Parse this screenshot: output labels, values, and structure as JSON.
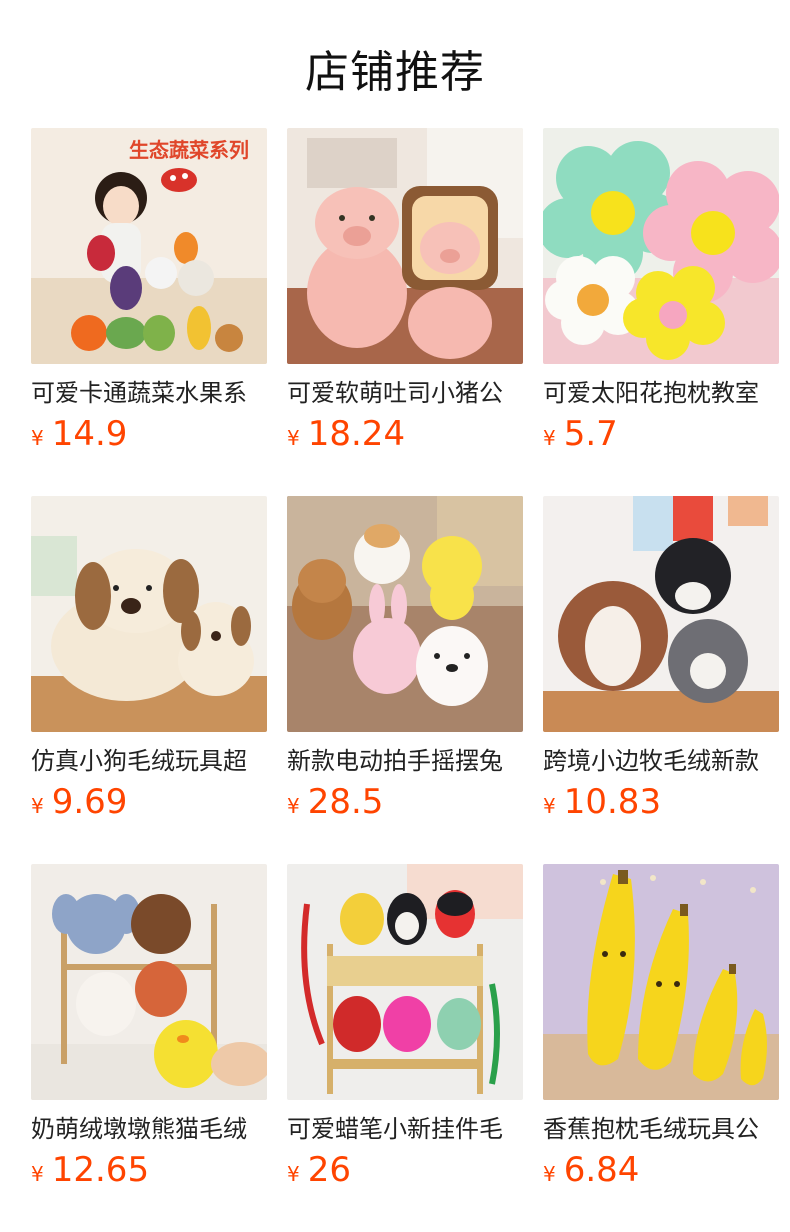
{
  "header": {
    "title": "店铺推荐"
  },
  "currency_symbol": "¥",
  "colors": {
    "price": "#ff4400",
    "title": "#111111"
  },
  "products": [
    {
      "name": "可爱卡通蔬菜水果系",
      "price": "14.9",
      "badge_text": "生态蔬菜系列"
    },
    {
      "name": "可爱软萌吐司小猪公",
      "price": "18.24"
    },
    {
      "name": "可爱太阳花抱枕教室",
      "price": "5.7"
    },
    {
      "name": "仿真小狗毛绒玩具超",
      "price": "9.69"
    },
    {
      "name": "新款电动拍手摇摆兔",
      "price": "28.5"
    },
    {
      "name": "跨境小边牧毛绒新款",
      "price": "10.83"
    },
    {
      "name": "奶萌绒墩墩熊猫毛绒",
      "price": "12.65"
    },
    {
      "name": "可爱蜡笔小新挂件毛",
      "price": "26"
    },
    {
      "name": "香蕉抱枕毛绒玩具公",
      "price": "6.84"
    }
  ]
}
